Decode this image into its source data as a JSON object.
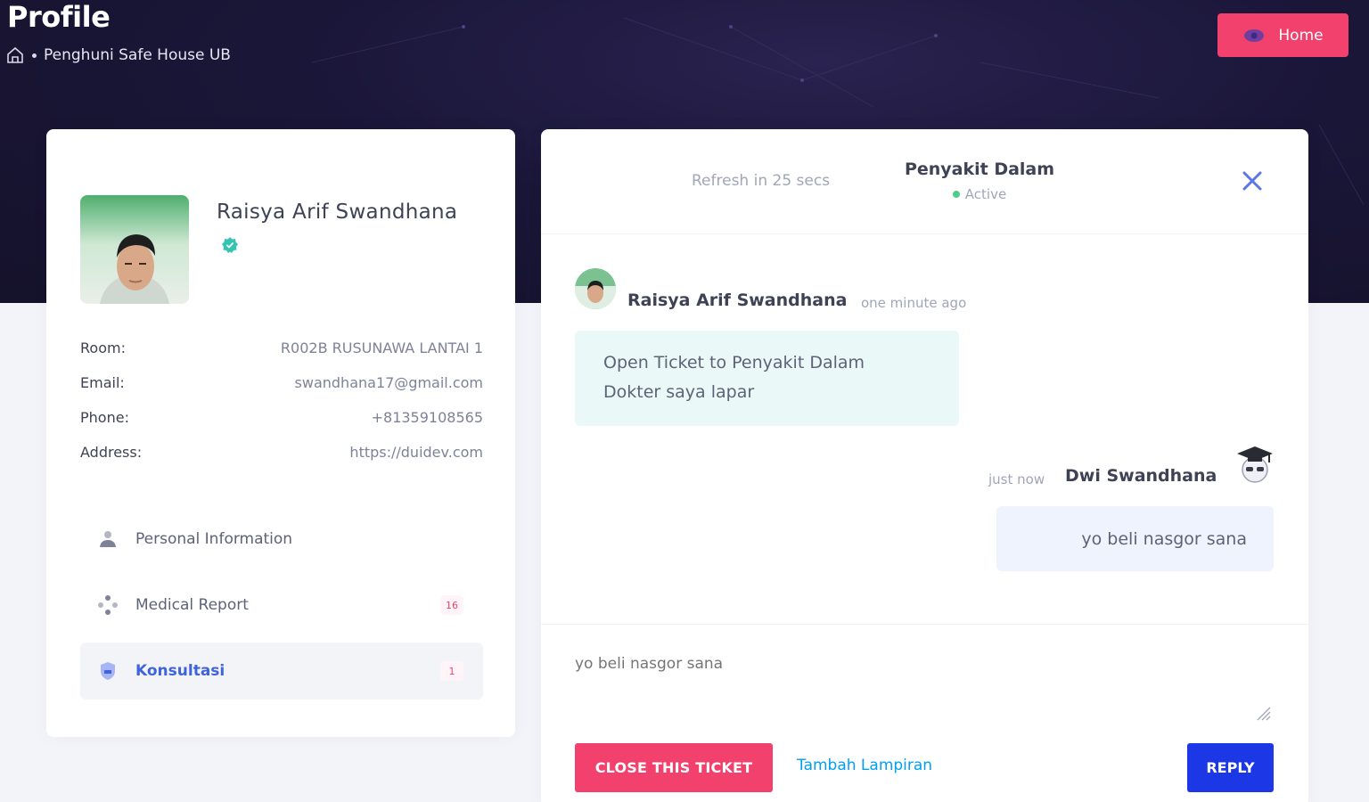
{
  "header": {
    "title": "Profile",
    "breadcrumb_item": "Penghuni Safe House UB",
    "home_button_label": "Home"
  },
  "profile": {
    "name": "Raisya Arif Swandhana",
    "details": [
      {
        "label": "Room:",
        "value": "R002B RUSUNAWA LANTAI 1"
      },
      {
        "label": "Email:",
        "value": "swandhana17@gmail.com"
      },
      {
        "label": "Phone:",
        "value": "+81359108565"
      },
      {
        "label": "Address:",
        "value": "https://duidev.com"
      }
    ],
    "nav": [
      {
        "label": "Personal Information",
        "icon": "user-icon",
        "badge": ""
      },
      {
        "label": "Medical Report",
        "icon": "medical-icon",
        "badge": "16"
      },
      {
        "label": "Konsultasi",
        "icon": "shield-icon",
        "badge": "1",
        "active": true
      }
    ]
  },
  "chat": {
    "refresh_text": "Refresh in 25 secs",
    "title": "Penyakit Dalam",
    "status": "Active",
    "messages": [
      {
        "sender": "Raisya Arif Swandhana",
        "time": "one minute ago",
        "lines": [
          "Open Ticket to Penyakit Dalam",
          "Dokter saya lapar"
        ]
      },
      {
        "sender": "Dwi Swandhana",
        "time": "just now",
        "text": "yo beli nasgor sana"
      }
    ],
    "reply_placeholder": "yo beli nasgor sana",
    "close_ticket_label": "CLOSE THIS TICKET",
    "attach_label": "Tambah Lampiran",
    "reply_label": "REPLY"
  },
  "colors": {
    "accent_pink": "#f1416c",
    "accent_blue": "#1c37e6",
    "status_green": "#50cd89"
  }
}
